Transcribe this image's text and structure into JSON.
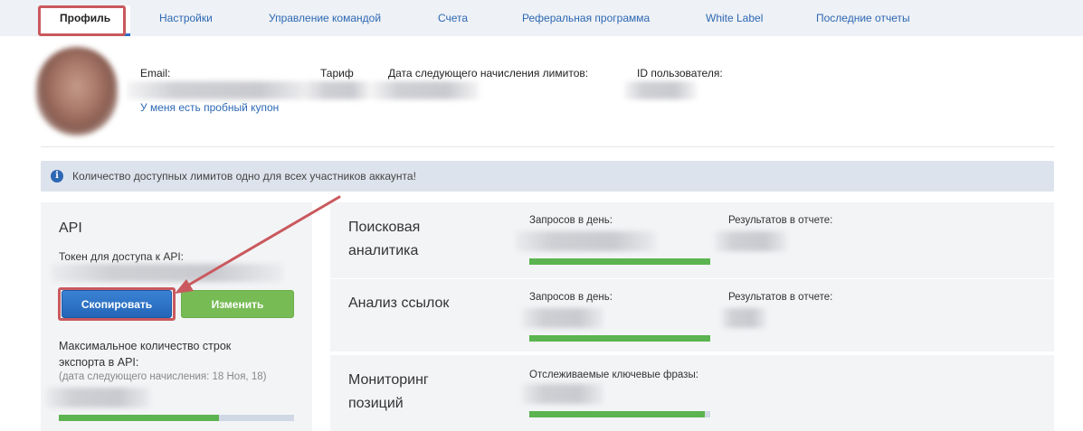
{
  "tabs": [
    {
      "label": "Профиль",
      "active": true
    },
    {
      "label": "Настройки"
    },
    {
      "label": "Управление командой"
    },
    {
      "label": "Счета"
    },
    {
      "label": "Реферальная программа"
    },
    {
      "label": "White Label"
    },
    {
      "label": "Последние отчеты"
    }
  ],
  "profile": {
    "email_label": "Email:",
    "plan_label": "Тариф",
    "next_charge_label": "Дата следующего начисления лимитов:",
    "user_id_label": "ID пользователя:",
    "coupon_link": "У меня есть пробный купон"
  },
  "notice": {
    "icon": "info-icon",
    "text": "Количество доступных лимитов одно для всех участников аккаунта!"
  },
  "api": {
    "title": "API",
    "token_label": "Токен для доступа к API:",
    "copy_button": "Скопировать",
    "change_button": "Изменить",
    "max_rows_label": "Максимальное количество строк экспорта в API:",
    "next_charge": "(дата следующего начисления: 18 Ноя, 18)",
    "usage_fraction": 0.68
  },
  "stats": [
    {
      "title": "Поисковая аналитика",
      "col1": "Запросов в день:",
      "col2": "Результатов в отчете:",
      "usage_fraction": 1.0
    },
    {
      "title": "Анализ ссылок",
      "col1": "Запросов в день:",
      "col2": "Результатов в отчете:",
      "usage_fraction": 1.0
    },
    {
      "title": "Мониторинг позиций",
      "col1": "Отслеживаемые ключевые фразы:",
      "usage_fraction": 0.97
    }
  ],
  "colors": {
    "accent": "#2d68b4",
    "highlight": "#c9595e",
    "progress": "#5bb450",
    "button_green": "#77bb55"
  }
}
